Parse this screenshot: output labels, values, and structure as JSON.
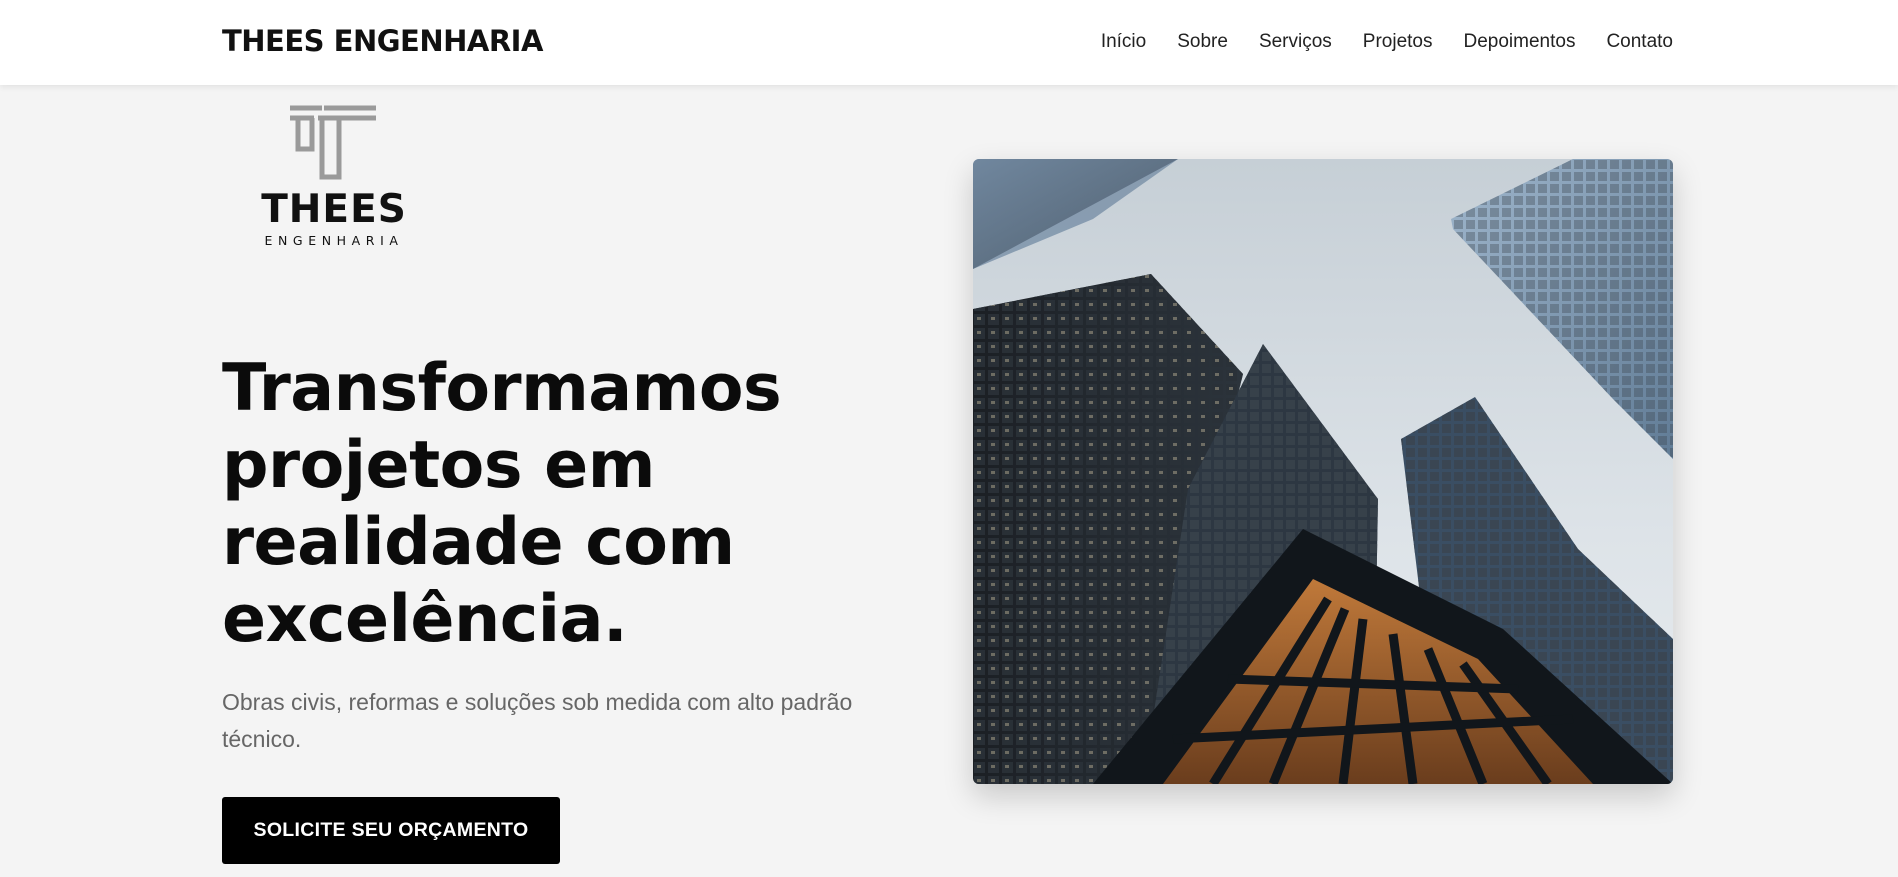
{
  "header": {
    "brand_bold": "THEES ENGENHARIA",
    "nav": [
      {
        "label": "Início"
      },
      {
        "label": "Sobre"
      },
      {
        "label": "Serviços"
      },
      {
        "label": "Projetos"
      },
      {
        "label": "Depoimentos"
      },
      {
        "label": "Contato"
      }
    ]
  },
  "logo": {
    "word": "THEES",
    "sub": "ENGENHARIA"
  },
  "hero": {
    "title_lines": [
      "Transformamos",
      "projetos em",
      "realidade com",
      "excelência."
    ],
    "subtitle": "Obras civis, reformas e soluções sob medida com alto padrão técnico.",
    "cta_label": "SOLICITE SEU ORÇAMENTO",
    "image_icon": "skyscrapers-photo"
  },
  "colors": {
    "background": "#f4f4f4",
    "header_bg": "#ffffff",
    "cta_bg": "#000000",
    "cta_text": "#ffffff",
    "subtitle": "#666666"
  }
}
